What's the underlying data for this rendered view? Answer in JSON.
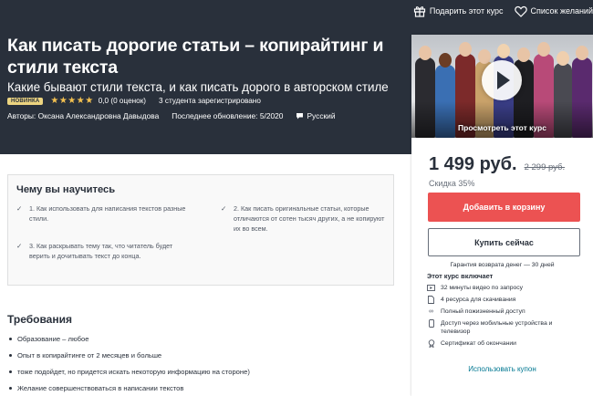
{
  "header": {
    "gift_label": "Подарить этот курс",
    "wishlist_label": "Список желаний",
    "title": "Как писать дорогие статьи – копирайтинг и стили текста",
    "subtitle": "Какие бывают стили текста, и как писать дорого в авторском стиле",
    "badge": "НОВИНКА",
    "stars": "★★★★★",
    "rating_text": "0,0 (0 оценок)",
    "students": "3 студента зарегистрировано",
    "author": "Авторы: Оксана Александровна Давыдова",
    "updated": "Последнее обновление: 5/2020",
    "language": "Русский"
  },
  "sidebar": {
    "preview_label": "Просмотреть этот курс",
    "price": "1 499 руб.",
    "old_price": "2 299 руб.",
    "discount": "Скидка 35%",
    "add_to_cart": "Добавить в корзину",
    "buy_now": "Купить сейчас",
    "guarantee": "Гарантия возврата денег — 30 дней",
    "includes_title": "Этот курс включает",
    "includes": [
      {
        "icon": "video-icon",
        "text": "32 минуты видео по запросу"
      },
      {
        "icon": "file-icon",
        "text": "4 ресурса для скачивания"
      },
      {
        "icon": "infinity-icon",
        "text": "Полный пожизненный доступ"
      },
      {
        "icon": "mobile-tv-icon",
        "text": "Доступ через мобильные устройства и телевизор"
      },
      {
        "icon": "certificate-icon",
        "text": "Сертификат об окончании"
      }
    ],
    "coupon": "Использовать купон"
  },
  "learn": {
    "title": "Чему вы научитесь",
    "items": [
      "1. Как использовать для написания текстов разные стили.",
      "2. Как писать оригинальные статьи, которые отличаются от сотен тысяч других, а не копируют их во всем.",
      "3. Как раскрывать тему так, что читатель будет верить и дочитывать текст до конца."
    ]
  },
  "requirements": {
    "title": "Требования",
    "items": [
      "Образование – любое",
      "Опыт в копирайтинге от 2 месяцев и больше",
      "тоже подойдет, но придется искать некоторую информацию на стороне)",
      "Желание совершенствоваться в написании текстов"
    ]
  },
  "colors": {
    "header_bg": "#29303b",
    "accent_red": "#ec5252",
    "star": "#f4c150",
    "link": "#007791",
    "badge": "#ecd480"
  }
}
